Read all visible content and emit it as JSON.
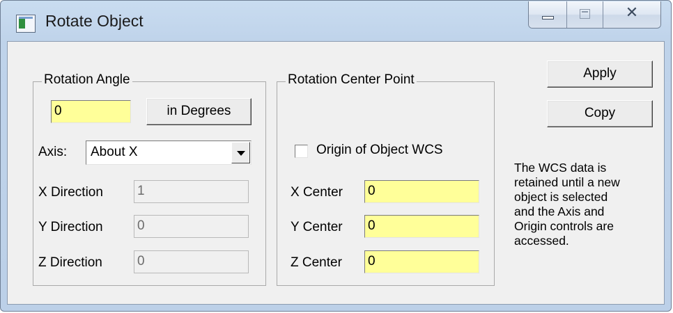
{
  "window": {
    "title": "Rotate Object",
    "close_glyph": "✕"
  },
  "rotation_angle": {
    "group_title": "Rotation Angle",
    "angle_value": "0",
    "units_button": "in Degrees",
    "axis_label": "Axis:",
    "axis_selected": "About X",
    "x_direction_label": "X Direction",
    "x_direction_value": "1",
    "y_direction_label": "Y Direction",
    "y_direction_value": "0",
    "z_direction_label": "Z Direction",
    "z_direction_value": "0"
  },
  "rotation_center": {
    "group_title": "Rotation Center Point",
    "origin_checkbox_label": "Origin of Object WCS",
    "origin_checked": false,
    "x_center_label": "X Center",
    "x_center_value": "0",
    "y_center_label": "Y Center",
    "y_center_value": "0",
    "z_center_label": "Z Center",
    "z_center_value": "0"
  },
  "actions": {
    "apply_label": "Apply",
    "copy_label": "Copy"
  },
  "info": {
    "lines": [
      "The WCS data is",
      "retained until a new",
      "object is selected",
      "and the Axis and",
      "Origin controls are",
      "accessed."
    ]
  },
  "colors": {
    "input_highlight": "#ffff99",
    "window_frame": "#c9dcf0",
    "dialog_face": "#f0f0f0"
  }
}
